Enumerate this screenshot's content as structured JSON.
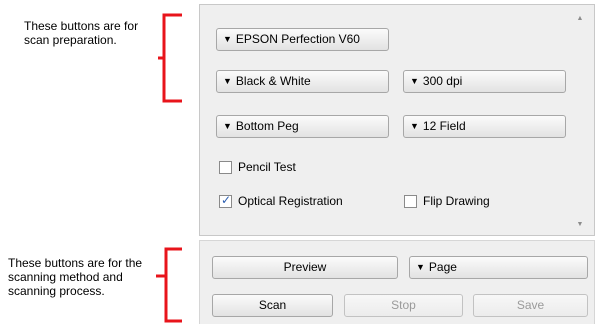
{
  "annotations": {
    "top": "These buttons are for scan preparation.",
    "bottom": "These buttons are for the scanning method and scanning process."
  },
  "colors": {
    "bracket": "#e8141b",
    "panel_bg": "#efefef",
    "check_accent": "#2a5db0"
  },
  "icons": {
    "dropdown": "triangle-down",
    "check": "check-mark",
    "scroll_up": "up-arrow",
    "scroll_down": "down-arrow"
  },
  "scanner": {
    "device": "EPSON Perfection V60",
    "color_mode": "Black & White",
    "resolution": "300 dpi",
    "peg": "Bottom Peg",
    "field": "12 Field"
  },
  "options": {
    "pencil_test": {
      "label": "Pencil Test",
      "checked": false
    },
    "optical_registration": {
      "label": "Optical Registration",
      "checked": true
    },
    "flip_drawing": {
      "label": "Flip Drawing",
      "checked": false
    }
  },
  "actions": {
    "preview": "Preview",
    "page": "Page",
    "scan": "Scan",
    "stop": "Stop",
    "save": "Save"
  }
}
